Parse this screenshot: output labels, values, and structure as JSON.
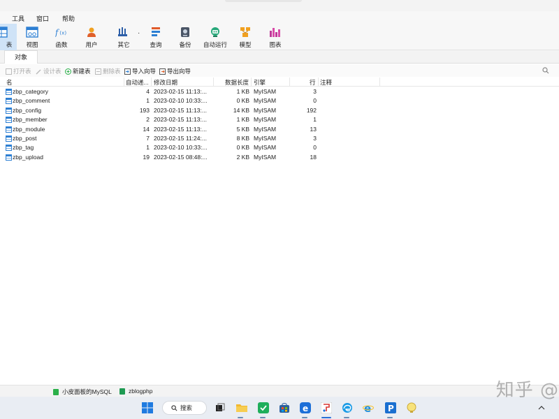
{
  "menu": [
    "工具",
    "窗口",
    "帮助"
  ],
  "toolbar": [
    {
      "label": "表",
      "icon": "table-icon"
    },
    {
      "label": "视图",
      "icon": "view-icon"
    },
    {
      "label": "函数",
      "icon": "function-icon"
    },
    {
      "label": "用户",
      "icon": "user-icon"
    },
    {
      "label": "其它",
      "icon": "other-icon"
    },
    {
      "label": "查询",
      "icon": "query-icon"
    },
    {
      "label": "备份",
      "icon": "backup-icon"
    },
    {
      "label": "自动运行",
      "icon": "automation-icon"
    },
    {
      "label": "模型",
      "icon": "model-icon"
    },
    {
      "label": "图表",
      "icon": "chart-icon"
    }
  ],
  "tabs": [
    "对象"
  ],
  "actions": [
    {
      "label": "打开表",
      "enabled": false
    },
    {
      "label": "设计表",
      "enabled": false
    },
    {
      "label": "新建表",
      "enabled": true
    },
    {
      "label": "删除表",
      "enabled": false
    },
    {
      "label": "导入向导",
      "enabled": true
    },
    {
      "label": "导出向导",
      "enabled": true
    }
  ],
  "columns": [
    "名",
    "自动递...",
    "修改日期",
    "数据长度",
    "引擎",
    "行",
    "注释"
  ],
  "rows": [
    {
      "name": "zbp_category",
      "auto": "4",
      "date": "2023-02-15 11:13:...",
      "size": "1 KB",
      "engine": "MyISAM",
      "rows": "3",
      "comment": ""
    },
    {
      "name": "zbp_comment",
      "auto": "1",
      "date": "2023-02-10 10:33:...",
      "size": "0 KB",
      "engine": "MyISAM",
      "rows": "0",
      "comment": ""
    },
    {
      "name": "zbp_config",
      "auto": "193",
      "date": "2023-02-15 11:13:...",
      "size": "14 KB",
      "engine": "MyISAM",
      "rows": "192",
      "comment": ""
    },
    {
      "name": "zbp_member",
      "auto": "2",
      "date": "2023-02-15 11:13:...",
      "size": "1 KB",
      "engine": "MyISAM",
      "rows": "1",
      "comment": ""
    },
    {
      "name": "zbp_module",
      "auto": "14",
      "date": "2023-02-15 11:13:...",
      "size": "5 KB",
      "engine": "MyISAM",
      "rows": "13",
      "comment": ""
    },
    {
      "name": "zbp_post",
      "auto": "7",
      "date": "2023-02-15 11:24:...",
      "size": "8 KB",
      "engine": "MyISAM",
      "rows": "3",
      "comment": ""
    },
    {
      "name": "zbp_tag",
      "auto": "1",
      "date": "2023-02-10 10:33:...",
      "size": "0 KB",
      "engine": "MyISAM",
      "rows": "0",
      "comment": ""
    },
    {
      "name": "zbp_upload",
      "auto": "19",
      "date": "2023-02-15 08:48:...",
      "size": "2 KB",
      "engine": "MyISAM",
      "rows": "18",
      "comment": ""
    }
  ],
  "status": {
    "connection": "小皮面板的MySQL",
    "database": "zblogphp"
  },
  "taskbar": {
    "search_label": "搜索"
  },
  "watermark": "知乎 @"
}
